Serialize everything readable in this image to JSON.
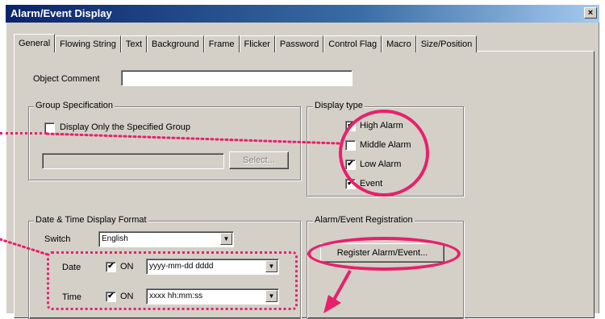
{
  "window": {
    "title": "Alarm/Event Display",
    "close_glyph": "×"
  },
  "tabs": [
    "General",
    "Flowing String",
    "Text",
    "Background",
    "Frame",
    "Flicker",
    "Password",
    "Control Flag",
    "Macro",
    "Size/Position"
  ],
  "object_comment": {
    "label": "Object Comment",
    "value": ""
  },
  "group_spec": {
    "title": "Group Specification",
    "checkbox_label": "Display Only the Specified Group",
    "checked": false,
    "field_value": "",
    "select_button": "Select..."
  },
  "display_type": {
    "title": "Display type",
    "items": [
      {
        "label": "High Alarm",
        "checked": true
      },
      {
        "label": "Middle Alarm",
        "checked": false
      },
      {
        "label": "Low Alarm",
        "checked": true
      },
      {
        "label": "Event",
        "checked": true
      }
    ]
  },
  "date_time": {
    "title": "Date & Time Display Format",
    "switch_label": "Switch",
    "switch_value": "English",
    "date_label": "Date",
    "date_on_label": "ON",
    "date_on": true,
    "date_format": "yyyy-mm-dd  dddd",
    "time_label": "Time",
    "time_on_label": "ON",
    "time_on": true,
    "time_format": "xxxx hh:mm:ss"
  },
  "registration": {
    "title": "Alarm/Event Registration",
    "button": "Register Alarm/Event..."
  },
  "annotation_color": "#e8206b",
  "check_glyph": "✔",
  "dropdown_glyph": "▼"
}
